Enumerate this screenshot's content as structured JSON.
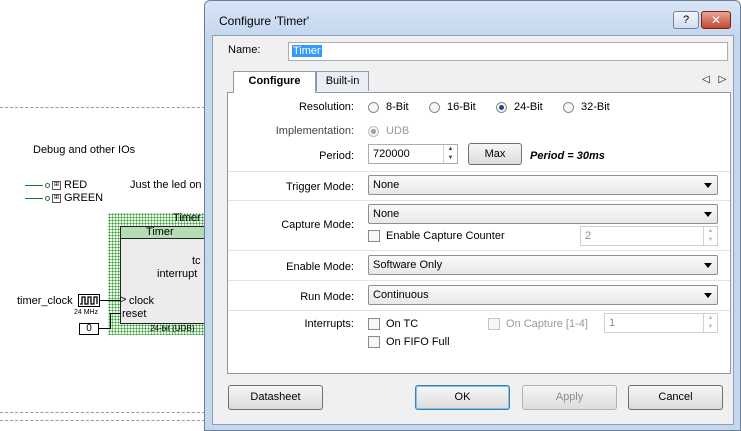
{
  "schematic": {
    "section_label": "Debug and other IOs",
    "pins": [
      "RED",
      "GREEN"
    ],
    "note": "Just the led on",
    "component_title": "Timer",
    "component_header": "Timer",
    "terminals": {
      "tc": "tc",
      "interrupt": "interrupt",
      "clock": "clock",
      "reset": "reset"
    },
    "clock_source": "timer_clock",
    "clock_freq": "24 MHz",
    "reset_value": "0",
    "implementation_note": "24-bit (UDB)"
  },
  "dialog": {
    "title": "Configure 'Timer'",
    "help_label": "?",
    "close_label": "✕",
    "name_label": "Name:",
    "name_value": "Timer",
    "tabs": [
      "Configure",
      "Built-in"
    ],
    "tab_arrows": "◁ ▷",
    "resolution": {
      "label": "Resolution:",
      "options": [
        "8-Bit",
        "16-Bit",
        "24-Bit",
        "32-Bit"
      ],
      "selected": "24-Bit"
    },
    "implementation": {
      "label": "Implementation:",
      "option": "UDB"
    },
    "period": {
      "label": "Period:",
      "value": "720000",
      "max_label": "Max",
      "note": "Period = 30ms"
    },
    "trigger_mode": {
      "label": "Trigger Mode:",
      "value": "None"
    },
    "capture_mode": {
      "label": "Capture Mode:",
      "value": "None",
      "enable_counter_label": "Enable Capture Counter",
      "counter_value": "2"
    },
    "enable_mode": {
      "label": "Enable Mode:",
      "value": "Software Only"
    },
    "run_mode": {
      "label": "Run Mode:",
      "value": "Continuous"
    },
    "interrupts": {
      "label": "Interrupts:",
      "on_tc": "On TC",
      "on_capture": "On Capture [1-4]",
      "capture_count": "1",
      "on_fifo_full": "On FIFO Full"
    },
    "buttons": {
      "datasheet": "Datasheet",
      "ok": "OK",
      "apply": "Apply",
      "cancel": "Cancel"
    }
  }
}
